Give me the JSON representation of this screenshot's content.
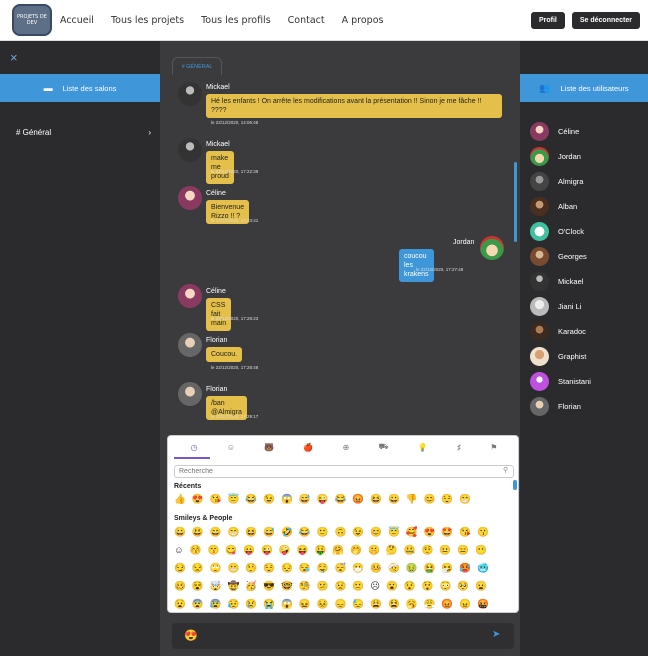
{
  "navbar": {
    "logo_text": "PROJETS DE DEV",
    "links": [
      "Accueil",
      "Tous les projets",
      "Tous les profils",
      "Contact",
      "A propos"
    ],
    "profile_label": "Profil",
    "logout_label": "Se déconnecter"
  },
  "left_panel": {
    "close_icon": "×",
    "header_label": "Liste des salons",
    "salons": [
      {
        "label": "# Général",
        "chevron": "›"
      }
    ]
  },
  "chat": {
    "tab_label": "# GÉNÉRAL",
    "messages": [
      {
        "author": "Mickael",
        "text": "Hé les enfants ! On arrête les modifications avant la présentation !! Sinon je me fâche !! ????",
        "date": "le 22/12/2020, 14:06:48"
      },
      {
        "author": "Mickael",
        "text": "make me proud",
        "date": "le 22/12/2020, 17:22:39"
      },
      {
        "author": "Céline",
        "text": "Bienvenue Rizzo !! ?",
        "date": "le 22/12/2020, 17:23:41"
      },
      {
        "author": "Jordan",
        "text": "coucou les krakens",
        "date": "le 22/12/2020, 17:27:49"
      },
      {
        "author": "Céline",
        "text": "CSS fait main",
        "date": "le 22/12/2020, 17:28:23"
      },
      {
        "author": "Florian",
        "text": "Coucou.",
        "date": "le 22/12/2020, 17:28:48"
      },
      {
        "author": "Florian",
        "text": "/ban @Almigra",
        "date": "le 22/12/2020, 17:29:17"
      }
    ]
  },
  "emoji_picker": {
    "categories": [
      "recent-icon",
      "smiley-icon",
      "animal-icon",
      "food-icon",
      "travel-icon",
      "car-icon",
      "bulb-icon",
      "symbols-icon",
      "flag-icon"
    ],
    "category_glyphs": [
      "◷",
      "☺",
      "🐻",
      "🍎",
      "⊕",
      "⛟",
      "💡",
      "♯",
      "⚑"
    ],
    "search_placeholder": "Recherche",
    "recent_title": "Récents",
    "recent": "👍😍😘😇😂😉😱😅😜😂😡😆😀👎😊😌😁",
    "smileys_title": "Smileys & People",
    "smileys_rows": [
      "😀😃😄😁😆😅🤣😂🙂🙃😉😊😇🥰😍🤩😘😗",
      "☺😚😙😋😛😜🤪😝🤑🤗🤭🤫🤔🤐🤨😐😑😶",
      "😏😒🙄😬🤥😌😔😪🤤😴😷🤒🤕🤢🤮🤧🥵🥶",
      "🥴😵🤯🤠🥳😎🤓🧐😕😟🙁☹😮😯😲😳🥺😦",
      "😧😨😰😥😢😭😱😖😣😞😓😩😫🥱😤😡😠🤬"
    ]
  },
  "input": {
    "value": "😍",
    "send_icon": "➤"
  },
  "right_panel": {
    "header_label": "Liste des utilisateurs",
    "users": [
      "Céline",
      "Jordan",
      "Almigra",
      "Alban",
      "O'Clock",
      "Georges",
      "Mickael",
      "Jiani Li",
      "Karadoc",
      "Graphist",
      "Stanistani",
      "Florian"
    ]
  },
  "colors": {
    "accent": "#3f97d9",
    "bubble": "#e4c04a",
    "dark": "#2b2b2e"
  }
}
